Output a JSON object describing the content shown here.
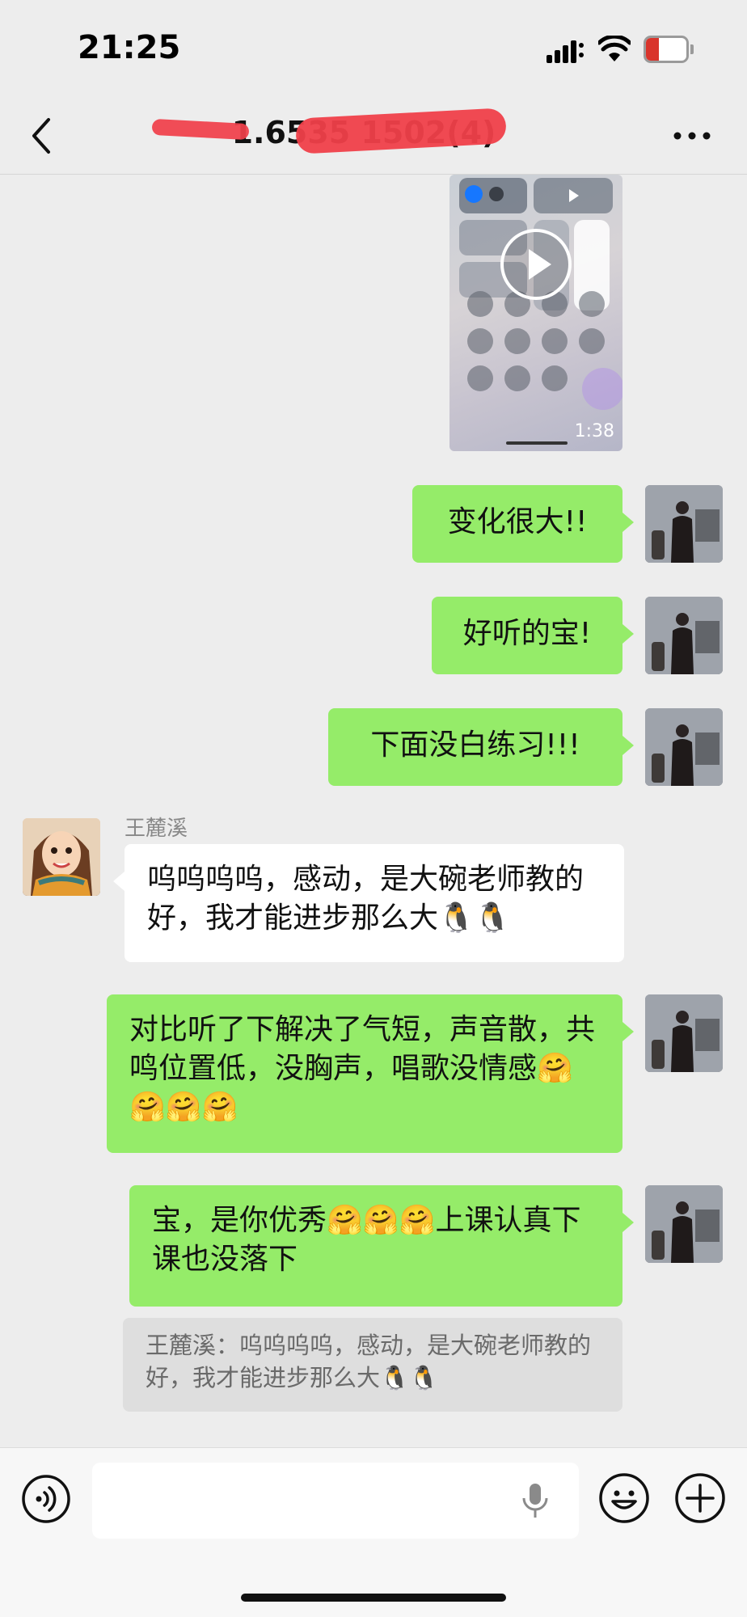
{
  "status_bar": {
    "time": "21:25",
    "battery_level": "9",
    "battery_fraction": 0.09,
    "battery_color": "#d9342b",
    "icons": [
      "signal-icon",
      "wifi-icon",
      "battery-icon"
    ]
  },
  "nav": {
    "title": "1.6535 1502(4)",
    "back_icon": "chevron-left-icon",
    "more_icon": "more-dots-icon"
  },
  "video": {
    "duration": "1:38",
    "icon": "play-icon"
  },
  "messages": [
    {
      "sender": "me",
      "text": "变化很大!!"
    },
    {
      "sender": "me",
      "text": "好听的宝!"
    },
    {
      "sender": "me",
      "text": "下面没白练习!!!"
    },
    {
      "sender": "her",
      "name": "王麓溪",
      "text": "呜呜呜呜，感动，是大碗老师教的好，我才能进步那么大🐧🐧"
    },
    {
      "sender": "me",
      "text": "对比听了下解决了气短，声音散，共鸣位置低，没胸声，唱歌没情感🤗🤗🤗🤗"
    },
    {
      "sender": "me",
      "text": "宝，是你优秀🤗🤗🤗上课认真下课也没落下"
    }
  ],
  "quote": {
    "text": "王麓溪：呜呜呜呜，感动，是大碗老师教的好，我才能进步那么大🐧🐧"
  },
  "input_bar": {
    "voice_icon": "voice-icon",
    "mic_icon": "mic-icon",
    "emoji_icon": "emoji-icon",
    "plus_icon": "plus-icon"
  },
  "colors": {
    "background": "#ededed",
    "my_bubble": "#95ec69",
    "her_bubble": "#ffffff"
  }
}
